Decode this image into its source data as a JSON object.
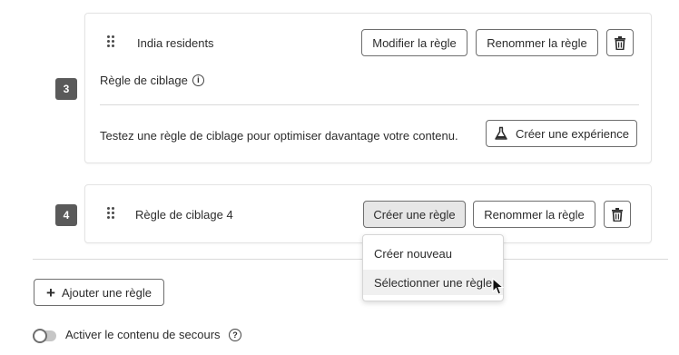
{
  "rules": [
    {
      "number": "3",
      "title": "India residents",
      "edit_label": "Modifier la règle",
      "rename_label": "Renommer la règle",
      "section_label": "Règle de ciblage",
      "promo_text": "Testez une règle de ciblage pour optimiser davantage votre contenu.",
      "experience_label": "Créer une expérience"
    },
    {
      "number": "4",
      "title": "Règle de ciblage 4",
      "create_label": "Créer une règle",
      "rename_label": "Renommer la règle"
    }
  ],
  "dropdown": {
    "items": [
      "Créer nouveau",
      "Sélectionner une règle"
    ]
  },
  "add_rule_label": "Ajouter une règle",
  "fallback": {
    "label": "Activer le contenu de secours",
    "enabled": false
  },
  "icons": {
    "drag": "drag-handle-icon",
    "delete": "trash-icon",
    "info": "info-icon",
    "flask": "flask-icon",
    "plus": "plus-icon",
    "help": "help-icon",
    "cursor": "mouse-pointer-icon"
  },
  "colors": {
    "badge": "#5a5a5a",
    "border": "#6e6e6e",
    "pressed": "#e6e6e6",
    "hover": "#f0f0f0"
  }
}
